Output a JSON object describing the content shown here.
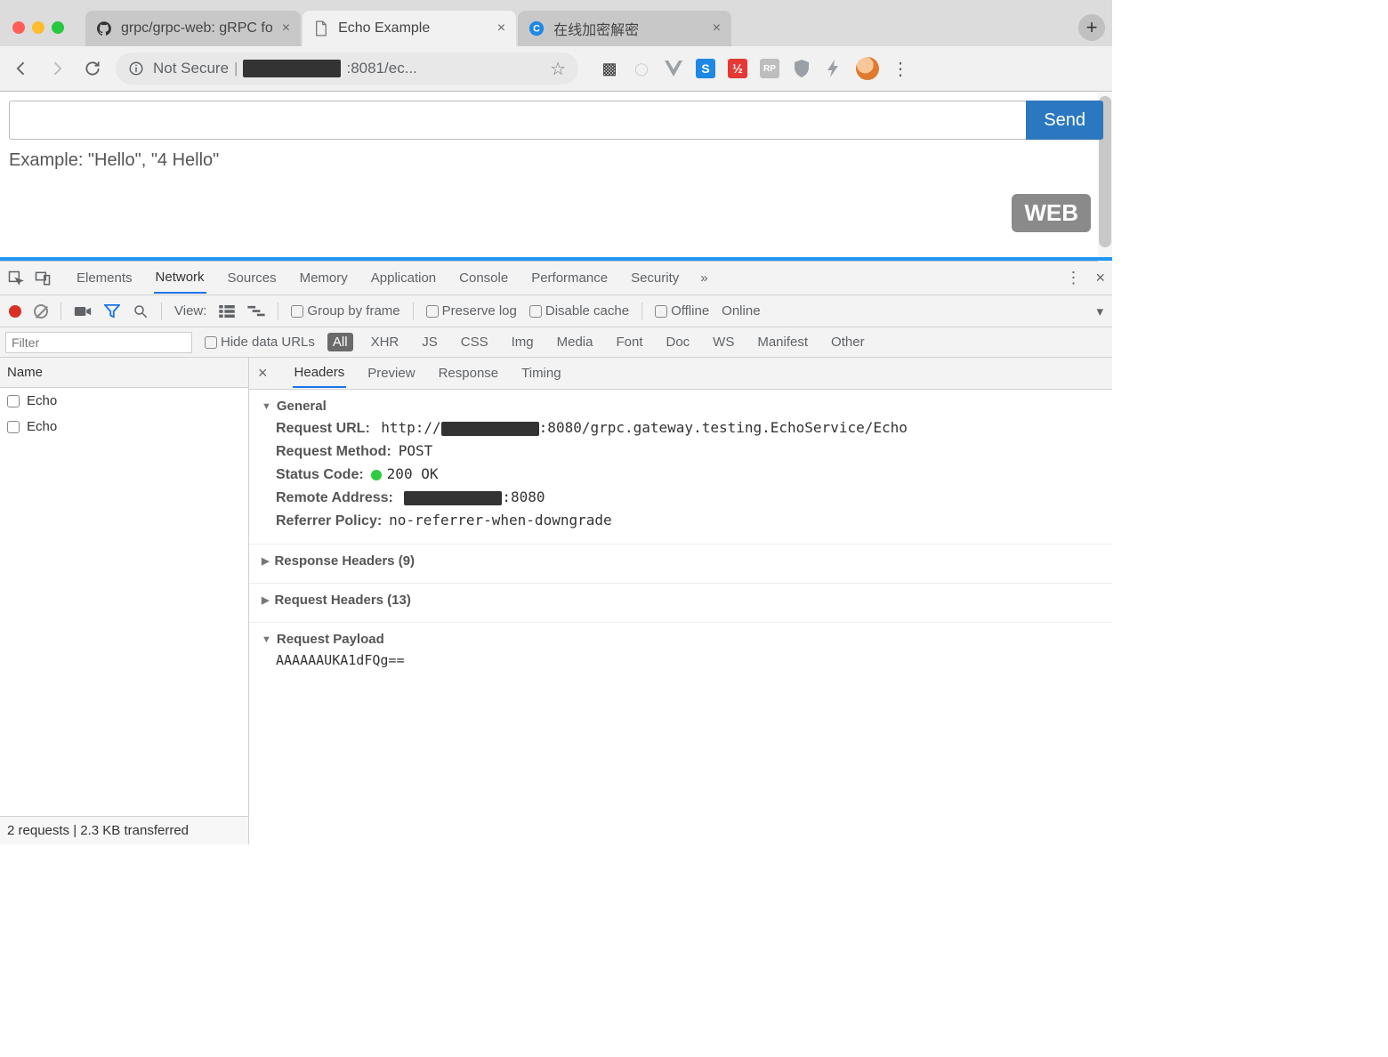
{
  "chrome": {
    "tabs": [
      {
        "title": "grpc/grpc-web: gRPC fo",
        "icon": "github"
      },
      {
        "title": "Echo Example",
        "icon": "file"
      },
      {
        "title": "在线加密解密",
        "icon": "circle-c"
      }
    ],
    "nav": {
      "not_secure": "Not Secure",
      "url_suffix": ":8081/ec..."
    }
  },
  "page": {
    "send_button": "Send",
    "example": "Example: \"Hello\", \"4 Hello\"",
    "web_badge": "WEB"
  },
  "devtools": {
    "panels": [
      "Elements",
      "Network",
      "Sources",
      "Memory",
      "Application",
      "Console",
      "Performance",
      "Security"
    ],
    "active_panel": "Network",
    "toolbar": {
      "view_label": "View:",
      "group_by_frame": "Group by frame",
      "preserve_log": "Preserve log",
      "disable_cache": "Disable cache",
      "offline": "Offline",
      "online": "Online"
    },
    "filter": {
      "placeholder": "Filter",
      "hide_label": "Hide data URLs",
      "types": [
        "All",
        "XHR",
        "JS",
        "CSS",
        "Img",
        "Media",
        "Font",
        "Doc",
        "WS",
        "Manifest",
        "Other"
      ],
      "active_type": "All"
    },
    "requests": {
      "header": "Name",
      "items": [
        "Echo",
        "Echo"
      ],
      "status": "2 requests | 2.3 KB transferred"
    },
    "detail": {
      "tabs": [
        "Headers",
        "Preview",
        "Response",
        "Timing"
      ],
      "active_tab": "Headers",
      "general_title": "General",
      "request_url_label": "Request URL:",
      "request_url_prefix": "http://",
      "request_url_suffix": ":8080/grpc.gateway.testing.EchoService/Echo",
      "request_method_label": "Request Method:",
      "request_method": "POST",
      "status_code_label": "Status Code:",
      "status_code": "200 OK",
      "remote_address_label": "Remote Address:",
      "remote_address_suffix": ":8080",
      "referrer_policy_label": "Referrer Policy:",
      "referrer_policy": "no-referrer-when-downgrade",
      "response_headers_title": "Response Headers (9)",
      "request_headers_title": "Request Headers (13)",
      "request_payload_title": "Request Payload",
      "request_payload": "AAAAAAUKA1dFQg=="
    }
  }
}
